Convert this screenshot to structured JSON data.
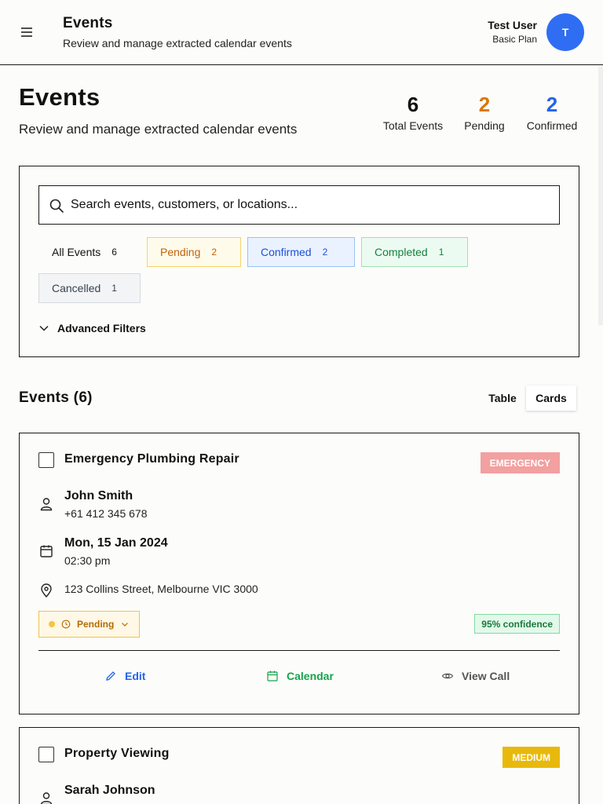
{
  "topbar": {
    "title": "Events",
    "subtitle": "Review and manage extracted calendar events",
    "user_name": "Test User",
    "user_plan": "Basic Plan",
    "avatar_initial": "T"
  },
  "page": {
    "title": "Events",
    "subtitle": "Review and manage extracted calendar events"
  },
  "stats": [
    {
      "value": "6",
      "label": "Total Events",
      "color": "#111111"
    },
    {
      "value": "2",
      "label": "Pending",
      "color": "#d97706"
    },
    {
      "value": "2",
      "label": "Confirmed",
      "color": "#2563eb"
    }
  ],
  "search": {
    "placeholder": "Search events, customers, or locations..."
  },
  "filters": [
    {
      "label": "All Events",
      "count": "6",
      "text_color": "#111111",
      "bg": "#fcfcfa",
      "border": "#fcfcfa"
    },
    {
      "label": "Pending",
      "count": "2",
      "text_color": "#c2620a",
      "bg": "#fffbeb",
      "border": "#f6d36a"
    },
    {
      "label": "Confirmed",
      "count": "2",
      "text_color": "#1d4ed8",
      "bg": "#eaf2ff",
      "border": "#9cc1f5"
    },
    {
      "label": "Completed",
      "count": "1",
      "text_color": "#15803d",
      "bg": "#ecfbf1",
      "border": "#9fe0b5"
    },
    {
      "label": "Cancelled",
      "count": "1",
      "text_color": "#374151",
      "bg": "#f3f4f6",
      "border": "#d6d9de"
    }
  ],
  "advanced_filters": "Advanced Filters",
  "section": {
    "title": "Events (6)",
    "view_table": "Table",
    "view_cards": "Cards"
  },
  "events": [
    {
      "title": "Emergency Plumbing Repair",
      "priority": "EMERGENCY",
      "priority_color": "#f2a0a0",
      "customer_name": "John Smith",
      "customer_phone": "+61 412 345 678",
      "date": "Mon, 15 Jan 2024",
      "time": "02:30 pm",
      "location": "123 Collins Street, Melbourne VIC 3000",
      "status": "Pending",
      "confidence": "95% confidence",
      "actions": {
        "edit": "Edit",
        "calendar": "Calendar",
        "view_call": "View Call"
      }
    },
    {
      "title": "Property Viewing",
      "priority": "MEDIUM",
      "priority_color": "#e8b90c",
      "customer_name": "Sarah Johnson"
    }
  ],
  "icons": {
    "menu": "menu-icon",
    "search": "search-icon",
    "chevron": "chevron-down-icon",
    "user": "user-icon",
    "calendar": "calendar-icon",
    "location": "map-pin-icon",
    "clock": "clock-icon",
    "edit": "pencil-icon",
    "eye": "eye-icon"
  }
}
